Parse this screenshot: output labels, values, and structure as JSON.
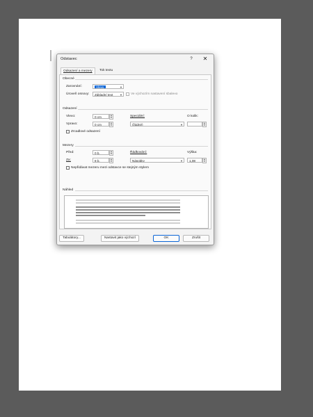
{
  "dialog": {
    "title": "Odstavec",
    "help_label": "?",
    "close_label": "✕",
    "tabs": [
      {
        "label": "Odsazení a mezery",
        "active": true
      },
      {
        "label": "Tok textu",
        "active": false
      }
    ]
  },
  "general": {
    "heading": "Obecné",
    "alignment_label": "Zarovnání:",
    "alignment_value": "Vlevo",
    "outline_level_label": "Úroveň osnovy:",
    "outline_level_value": "Základní text",
    "collapsed_default_label": "Ve výchozím nastavení sbalено"
  },
  "indent": {
    "heading": "Odsazení",
    "left_label": "Vlevo:",
    "left_value": "0 cm",
    "right_label": "Vpravo:",
    "right_value": "0 cm",
    "special_label": "Speciální:",
    "special_value": "(žádné)",
    "by_label": "O kolik:",
    "by_value": "",
    "mirror_label": "Zrcadlové odsazení"
  },
  "spacing": {
    "heading": "Mezery",
    "before_label": "Před:",
    "before_value": "0 b.",
    "after_label": "Za:",
    "after_value": "8 b.",
    "line_spacing_label": "Řádkování:",
    "line_spacing_value": "Násobky",
    "at_label": "Výška:",
    "at_value": "1,08",
    "dont_add_label": "Nepřidávat mezeru mezi odstavce se stejným stylem"
  },
  "preview": {
    "heading": "Náhled"
  },
  "buttons": {
    "tabs_label": "Tabulátory...",
    "set_default_label": "Nastavit jako výchozí",
    "ok_label": "OK",
    "cancel_label": "Zrušit"
  },
  "colors": {
    "accent": "#0a64d6",
    "backdrop": "#5b5b5b",
    "dialog_bg": "#f3f3f3"
  }
}
